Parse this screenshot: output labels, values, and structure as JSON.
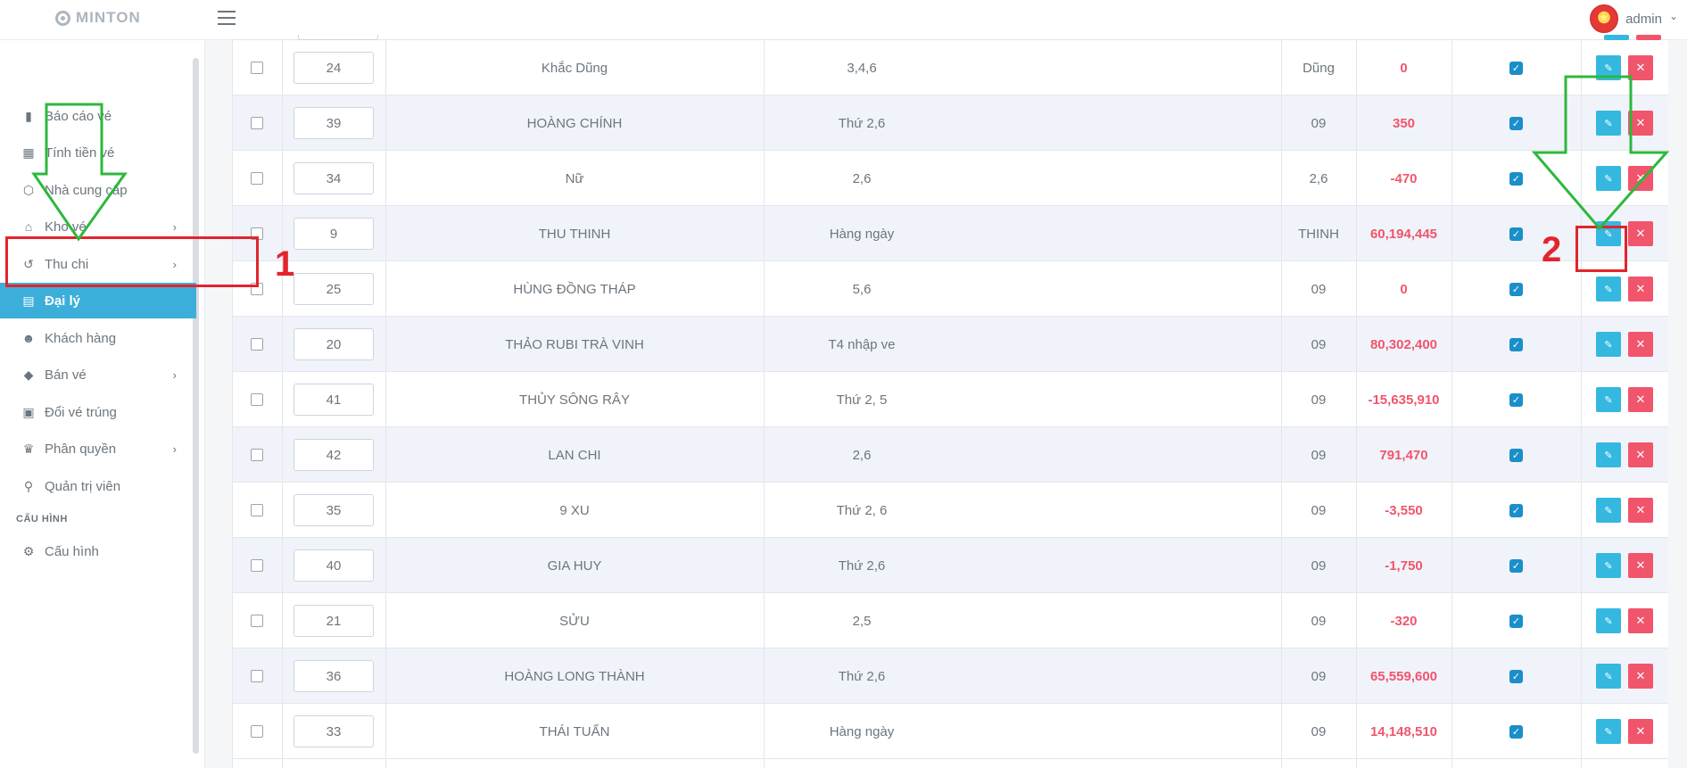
{
  "header": {
    "logo_text": "MINTON",
    "user_name": "admin",
    "user_chevron": "⌄"
  },
  "sidebar": {
    "items": [
      {
        "label": "Báo cáo vé",
        "icon": "bar-chart-icon",
        "glyph": "▮",
        "has_children": false
      },
      {
        "label": "Tính tiền vé",
        "icon": "calculator-icon",
        "glyph": "▦",
        "has_children": false
      },
      {
        "label": "Nhà cung cấp",
        "icon": "box-icon",
        "glyph": "⬡",
        "has_children": false
      },
      {
        "label": "Kho vé",
        "icon": "home-icon",
        "glyph": "⌂",
        "has_children": true
      },
      {
        "label": "Thu chi",
        "icon": "history-icon",
        "glyph": "↺",
        "has_children": true
      },
      {
        "label": "Đại lý",
        "icon": "building-icon",
        "glyph": "▤",
        "has_children": false,
        "active": true
      },
      {
        "label": "Khách hàng",
        "icon": "smile-icon",
        "glyph": "☻",
        "has_children": false
      },
      {
        "label": "Bán vé",
        "icon": "tag-icon",
        "glyph": "◆",
        "has_children": true
      },
      {
        "label": "Đổi vé trúng",
        "icon": "ticket-icon",
        "glyph": "▣",
        "has_children": false
      },
      {
        "label": "Phân quyền",
        "icon": "crown-icon",
        "glyph": "♛",
        "has_children": true
      },
      {
        "label": "Quản trị viên",
        "icon": "user-key-icon",
        "glyph": "⚲",
        "has_children": false
      }
    ],
    "section_label": "CẤU HÌNH",
    "config_item": {
      "label": "Cấu hình",
      "icon": "gear-icon",
      "glyph": "⚙"
    }
  },
  "table": {
    "rows": [
      {
        "order": "24",
        "name": "Khắc Dũng",
        "schedule": "3,4,6",
        "code": "Dũng",
        "balance": "0"
      },
      {
        "order": "39",
        "name": "HOÀNG CHÍNH",
        "schedule": "Thứ 2,6",
        "code": "09",
        "balance": "350"
      },
      {
        "order": "34",
        "name": "Nữ",
        "schedule": "2,6",
        "code": "2,6",
        "balance": "-470"
      },
      {
        "order": "9",
        "name": "THU THINH",
        "schedule": "Hàng ngày",
        "code": "THINH",
        "balance": "60,194,445"
      },
      {
        "order": "25",
        "name": "HÙNG ĐỒNG THÁP",
        "schedule": "5,6",
        "code": "09",
        "balance": "0"
      },
      {
        "order": "20",
        "name": "THẢO RUBI TRÀ VINH",
        "schedule": "T4 nhập ve",
        "code": "09",
        "balance": "80,302,400"
      },
      {
        "order": "41",
        "name": "THỦY SÔNG RÂY",
        "schedule": "Thứ 2, 5",
        "code": "09",
        "balance": "-15,635,910"
      },
      {
        "order": "42",
        "name": "LAN CHI",
        "schedule": "2,6",
        "code": "09",
        "balance": "791,470"
      },
      {
        "order": "35",
        "name": "9 XU",
        "schedule": "Thứ 2, 6",
        "code": "09",
        "balance": "-3,550"
      },
      {
        "order": "40",
        "name": "GIA HUY",
        "schedule": "Thứ 2,6",
        "code": "09",
        "balance": "-1,750"
      },
      {
        "order": "21",
        "name": "SỬU",
        "schedule": "2,5",
        "code": "09",
        "balance": "-320"
      },
      {
        "order": "36",
        "name": "HOÀNG LONG THÀNH",
        "schedule": "Thứ 2,6",
        "code": "09",
        "balance": "65,559,600"
      },
      {
        "order": "33",
        "name": "THÁI TUẤN",
        "schedule": "Hàng ngày",
        "code": "09",
        "balance": "14,148,510"
      }
    ]
  },
  "annotations": {
    "step1_number": "1",
    "step2_number": "2",
    "arrow_color": "#2db83d",
    "box_color": "#e3242b"
  },
  "icons": {
    "edit": "✎",
    "delete": "✕",
    "check": "✓",
    "chevron": "›"
  }
}
